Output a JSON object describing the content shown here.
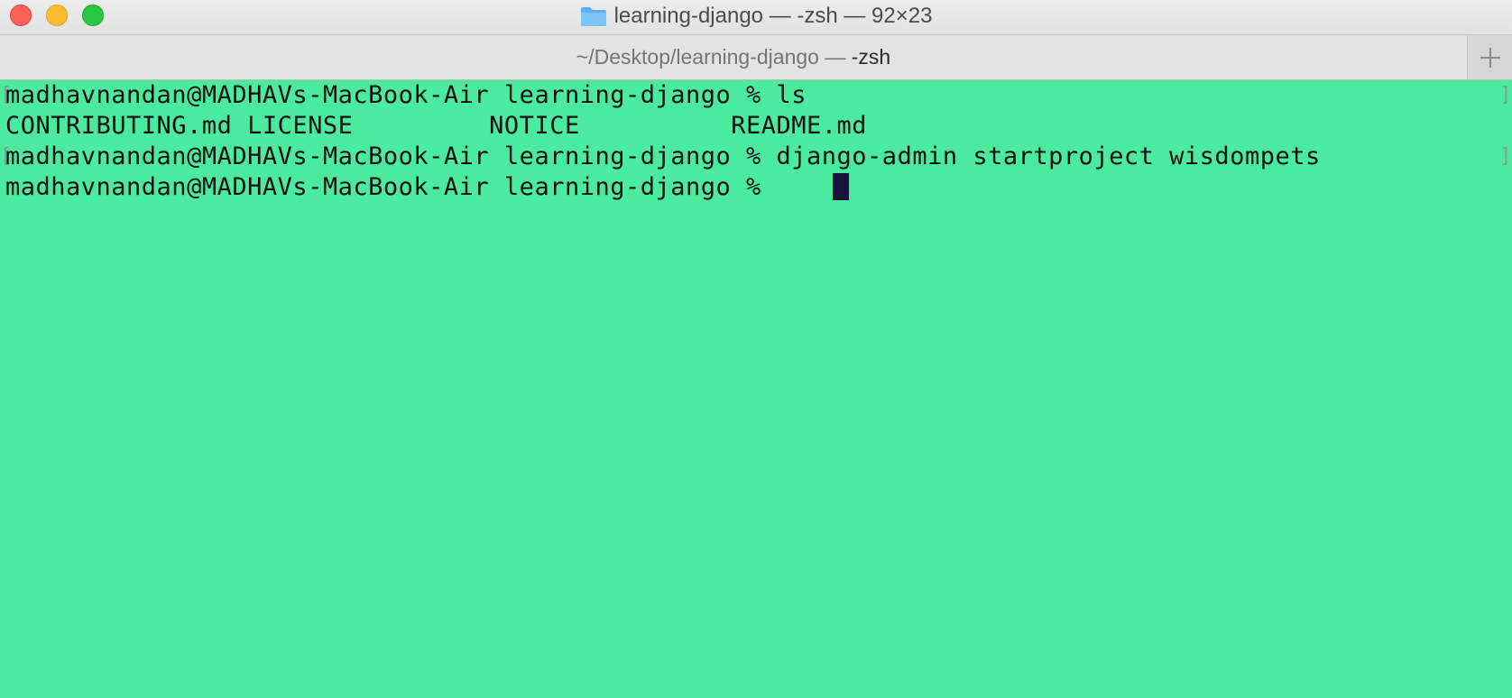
{
  "window": {
    "title": "learning-django — -zsh — 92×23",
    "icons": {
      "folder": "folder-icon",
      "close": "close-button",
      "minimize": "minimize-button",
      "zoom": "zoom-button",
      "new_tab": "plus-icon"
    }
  },
  "tab": {
    "path": "~/Desktop/learning-django —",
    "shell": "-zsh"
  },
  "terminal": {
    "background": "#4beb9f",
    "text_color": "#101010",
    "cursor_color": "#14133a",
    "lines": [
      "madhavnandan@MADHAVs-MacBook-Air learning-django % ls",
      "CONTRIBUTING.md LICENSE         NOTICE          README.md",
      "madhavnandan@MADHAVs-MacBook-Air learning-django % django-admin startproject wisdompets",
      "madhavnandan@MADHAVs-MacBook-Air learning-django % "
    ]
  }
}
